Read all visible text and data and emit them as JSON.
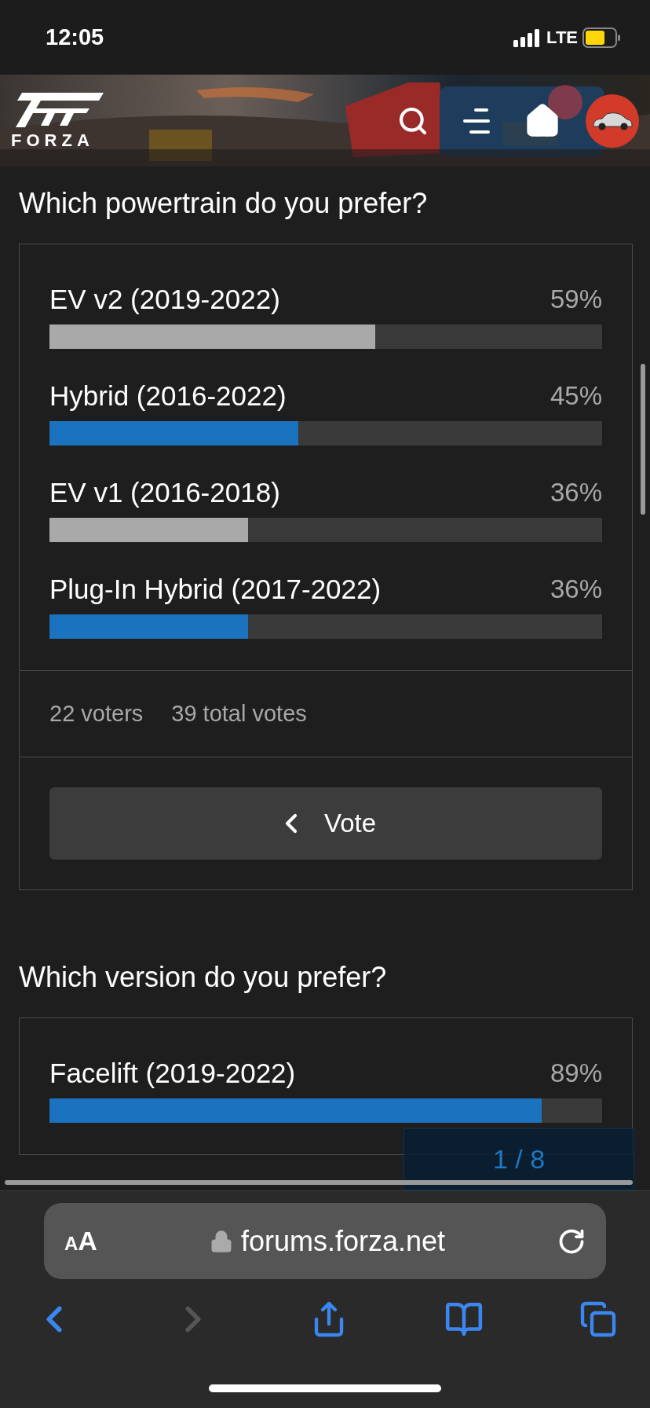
{
  "status_bar": {
    "time": "12:05",
    "network": "LTE"
  },
  "header": {
    "logo_text": "FORZA"
  },
  "polls": [
    {
      "question": "Which powertrain do you prefer?",
      "options": [
        {
          "label": "EV v2 (2019-2022)",
          "percent": "59%",
          "level": 0.59,
          "voted": false
        },
        {
          "label": "Hybrid (2016-2022)",
          "percent": "45%",
          "level": 0.45,
          "voted": true
        },
        {
          "label": "EV v1 (2016-2018)",
          "percent": "36%",
          "level": 0.36,
          "voted": false
        },
        {
          "label": "Plug-In Hybrid (2017-2022)",
          "percent": "36%",
          "level": 0.36,
          "voted": true
        }
      ],
      "voters": "22 voters",
      "total_votes": "39 total votes",
      "vote_button": "Vote"
    },
    {
      "question": "Which version do you prefer?",
      "options": [
        {
          "label": "Facelift (2019-2022)",
          "percent": "89%",
          "level": 0.89,
          "voted": true
        }
      ]
    }
  ],
  "page_counter": "1 / 8",
  "browser": {
    "text_size_button": "AA",
    "url": "forums.forza.net"
  }
}
